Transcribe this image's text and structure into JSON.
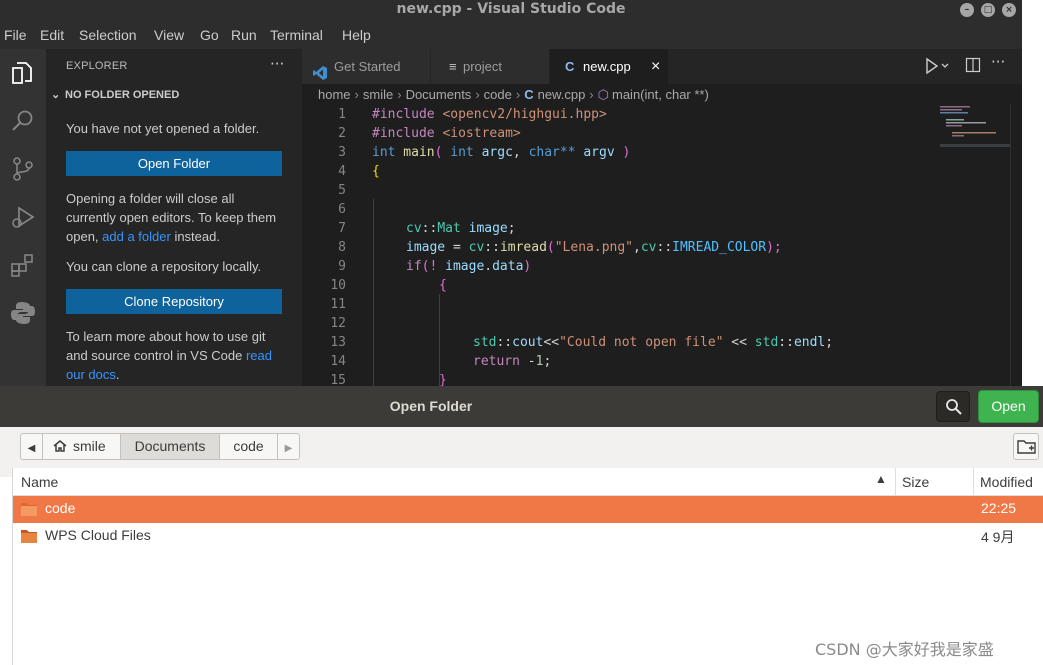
{
  "window": {
    "title": "new.cpp - Visual Studio Code"
  },
  "menu": [
    "File",
    "Edit",
    "Selection",
    "View",
    "Go",
    "Run",
    "Terminal",
    "Help"
  ],
  "activity_icons": [
    "files-icon",
    "search-icon",
    "source-control-icon",
    "run-debug-icon",
    "extensions-icon",
    "python-icon"
  ],
  "explorer": {
    "header": "EXPLORER",
    "more": "···",
    "section": "NO FOLDER OPENED",
    "msg1": "You have not yet opened a folder.",
    "open_folder_btn": "Open Folder",
    "msg2_a": "Opening a folder will close all currently open editors. To keep them open, ",
    "msg2_link": "add a folder",
    "msg2_b": " instead.",
    "msg3": "You can clone a repository locally.",
    "clone_btn": "Clone Repository",
    "msg4_a": "To learn more about how to use git and source control in VS Code ",
    "msg4_link": "read our docs",
    "msg4_b": "."
  },
  "tabs": [
    {
      "label": "Get Started",
      "icon": "vscode-icon"
    },
    {
      "label": "project",
      "icon": "file-icon"
    },
    {
      "label": "new.cpp",
      "icon": "cpp-icon",
      "close": "×"
    }
  ],
  "breadcrumb": [
    "home",
    "smile",
    "Documents",
    "code",
    "new.cpp",
    "main(int, char **)"
  ],
  "code_lines": [
    "1",
    "2",
    "3",
    "4",
    "5",
    "6",
    "7",
    "8",
    "9",
    "10",
    "11",
    "12",
    "13",
    "14",
    "15"
  ],
  "code": {
    "l1a": "#include ",
    "l1b": "<opencv2/highgui.hpp>",
    "l2a": "#include ",
    "l2b": "<iostream>",
    "l3a": "int",
    "l3b": " main",
    "l3c": "( ",
    "l3d": "int",
    "l3e": " argc",
    "l3f": ", ",
    "l3g": "char**",
    "l3h": " argv",
    "l3i": " )",
    "l4": "{",
    "l7a": "cv",
    "l7b": "::",
    "l7c": "Mat",
    "l7d": " image",
    "l7e": ";",
    "l8a": "image",
    "l8b": " = ",
    "l8c": "cv",
    "l8d": "::",
    "l8e": "imread",
    "l8f": "(",
    "l8g": "\"Lena.png\"",
    "l8h": ",",
    "l8i": "cv",
    "l8j": "::",
    "l8k": "IMREAD_COLOR",
    "l8l": ");",
    "l9a": "if",
    "l9b": "(! ",
    "l9c": "image",
    "l9d": ".",
    "l9e": "data",
    "l9f": ")",
    "l10": "{",
    "l13a": "std",
    "l13b": "::",
    "l13c": "cout",
    "l13d": "<<",
    "l13e": "\"Could not open file\"",
    "l13f": " << ",
    "l13g": "std",
    "l13h": "::",
    "l13i": "endl",
    "l13j": ";",
    "l14a": "return",
    "l14b": " -",
    "l14c": "1",
    "l14d": ";",
    "l15": "}"
  },
  "dialog": {
    "title": "Open Folder",
    "open_btn": "Open",
    "path": [
      "smile",
      "Documents",
      "code"
    ],
    "columns": {
      "name": "Name",
      "size": "Size",
      "modified": "Modified"
    },
    "rows": [
      {
        "name": "code",
        "modified": "22:25",
        "selected": true
      },
      {
        "name": "WPS Cloud Files",
        "modified": "4 9月",
        "selected": false
      }
    ]
  },
  "watermark": "CSDN @大家好我是家盛",
  "colors": {
    "accent_blue": "#0e639c",
    "selection_orange": "#f07746",
    "open_green": "#3eb34f"
  }
}
